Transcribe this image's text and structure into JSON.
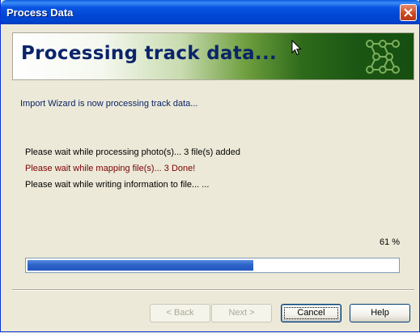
{
  "window": {
    "title": "Process Data"
  },
  "banner": {
    "title": "Processing track data..."
  },
  "subtitle": "Import Wizard is now processing track data...",
  "status_lines": [
    "Please wait while processing photo(s)... 3 file(s) added",
    "Please wait while mapping file(s)... 3 Done!",
    "Please wait while writing information to file... ..."
  ],
  "progress": {
    "label": "61 %",
    "fraction": 0.61
  },
  "buttons": {
    "back": "< Back",
    "next": "Next >",
    "cancel": "Cancel",
    "help": "Help"
  },
  "colors": {
    "title_bar": "#0054e3",
    "banner_green": "#1b5613",
    "progress_fill": "#2c64c8",
    "mapping_line": "#7a0000"
  },
  "icons": {
    "close": "close-icon",
    "logo": "network-nodes-icon",
    "cursor": "mouse-pointer-icon"
  }
}
